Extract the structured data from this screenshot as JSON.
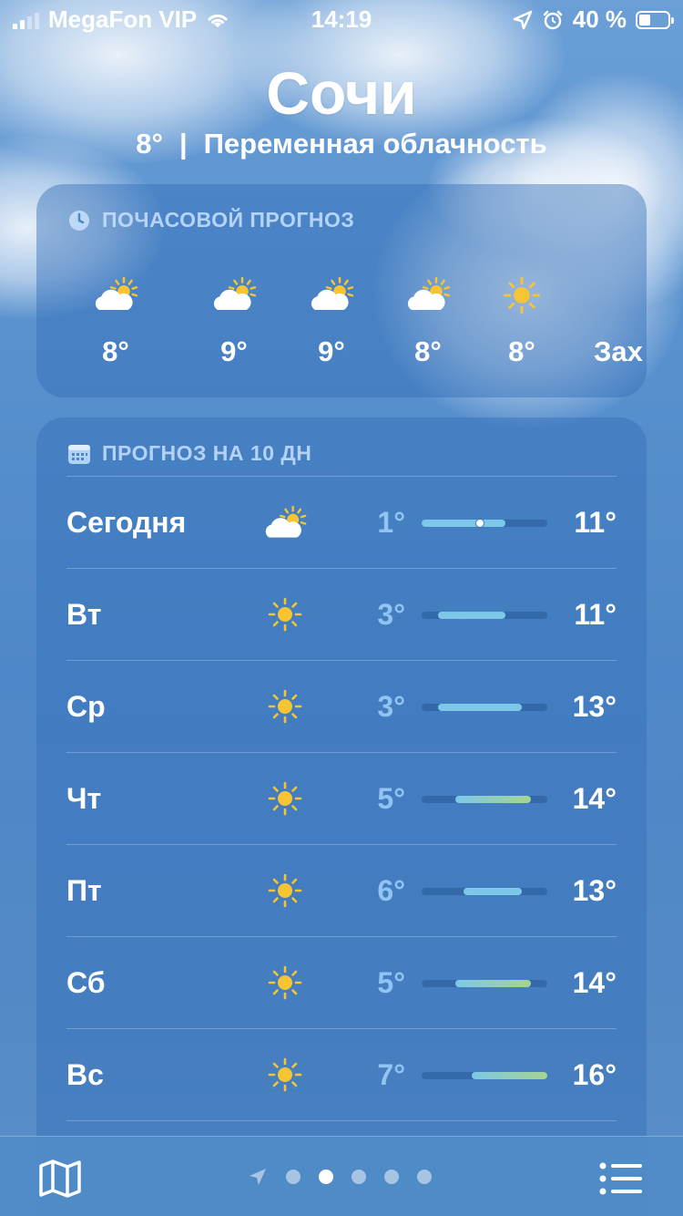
{
  "status_bar": {
    "carrier": "MegaFon VIP",
    "time": "14:19",
    "battery_percent": "40 %",
    "battery_level": 0.4
  },
  "header": {
    "city": "Сочи",
    "temperature": "8°",
    "separator": "|",
    "condition": "Переменная облачность"
  },
  "hourly": {
    "title": "ПОЧАСОВОЙ ПРОГНОЗ",
    "items": [
      {
        "icon": "partly-cloudy-icon",
        "temp": "8°"
      },
      {
        "icon": "partly-cloudy-icon",
        "temp": "9°"
      },
      {
        "icon": "partly-cloudy-icon",
        "temp": "9°"
      },
      {
        "icon": "partly-cloudy-icon",
        "temp": "8°"
      },
      {
        "icon": "sun-icon",
        "temp": "8°"
      },
      {
        "icon": "",
        "temp": "Зах"
      }
    ]
  },
  "daily": {
    "title": "ПРОГНОЗ НА 10 ДН",
    "range_min": 1,
    "range_max": 16,
    "days": [
      {
        "name": "Сегодня",
        "icon": "partly-cloudy-icon",
        "low": "1°",
        "high": "11°",
        "low_value": 1,
        "high_value": 11,
        "current_value": 8
      },
      {
        "name": "Вт",
        "icon": "sun-icon",
        "low": "3°",
        "high": "11°",
        "low_value": 3,
        "high_value": 11
      },
      {
        "name": "Ср",
        "icon": "sun-icon",
        "low": "3°",
        "high": "13°",
        "low_value": 3,
        "high_value": 13
      },
      {
        "name": "Чт",
        "icon": "sun-icon",
        "low": "5°",
        "high": "14°",
        "low_value": 5,
        "high_value": 14
      },
      {
        "name": "Пт",
        "icon": "sun-icon",
        "low": "6°",
        "high": "13°",
        "low_value": 6,
        "high_value": 13
      },
      {
        "name": "Сб",
        "icon": "sun-icon",
        "low": "5°",
        "high": "14°",
        "low_value": 5,
        "high_value": 14
      },
      {
        "name": "Вс",
        "icon": "sun-icon",
        "low": "7°",
        "high": "16°",
        "low_value": 7,
        "high_value": 16
      }
    ]
  },
  "colors": {
    "sun": "#f7c531",
    "bar_cool": "#7dc8e8",
    "bar_warm": "#a6d490"
  },
  "pager": {
    "pages": 5,
    "active_index": 1
  }
}
